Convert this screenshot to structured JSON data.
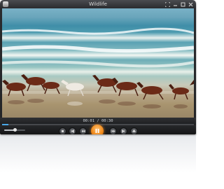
{
  "app": {
    "title": "Wildlife"
  },
  "playback": {
    "time_display": "00:01 / 00:30",
    "progress": 0.033,
    "volume": 0.5
  },
  "icons": {
    "app": "player-logo-icon",
    "window_controls": [
      "fullscreen-icon",
      "minimize-icon",
      "maximize-icon",
      "close-icon"
    ],
    "transport": [
      "stop-icon",
      "previous-icon",
      "rewind-icon",
      "pause-icon",
      "fast-forward-icon",
      "next-icon",
      "open-file-icon"
    ]
  },
  "colors": {
    "accent": "#f08a1c",
    "seek": "#4aa8e8",
    "chrome": "#232426"
  }
}
